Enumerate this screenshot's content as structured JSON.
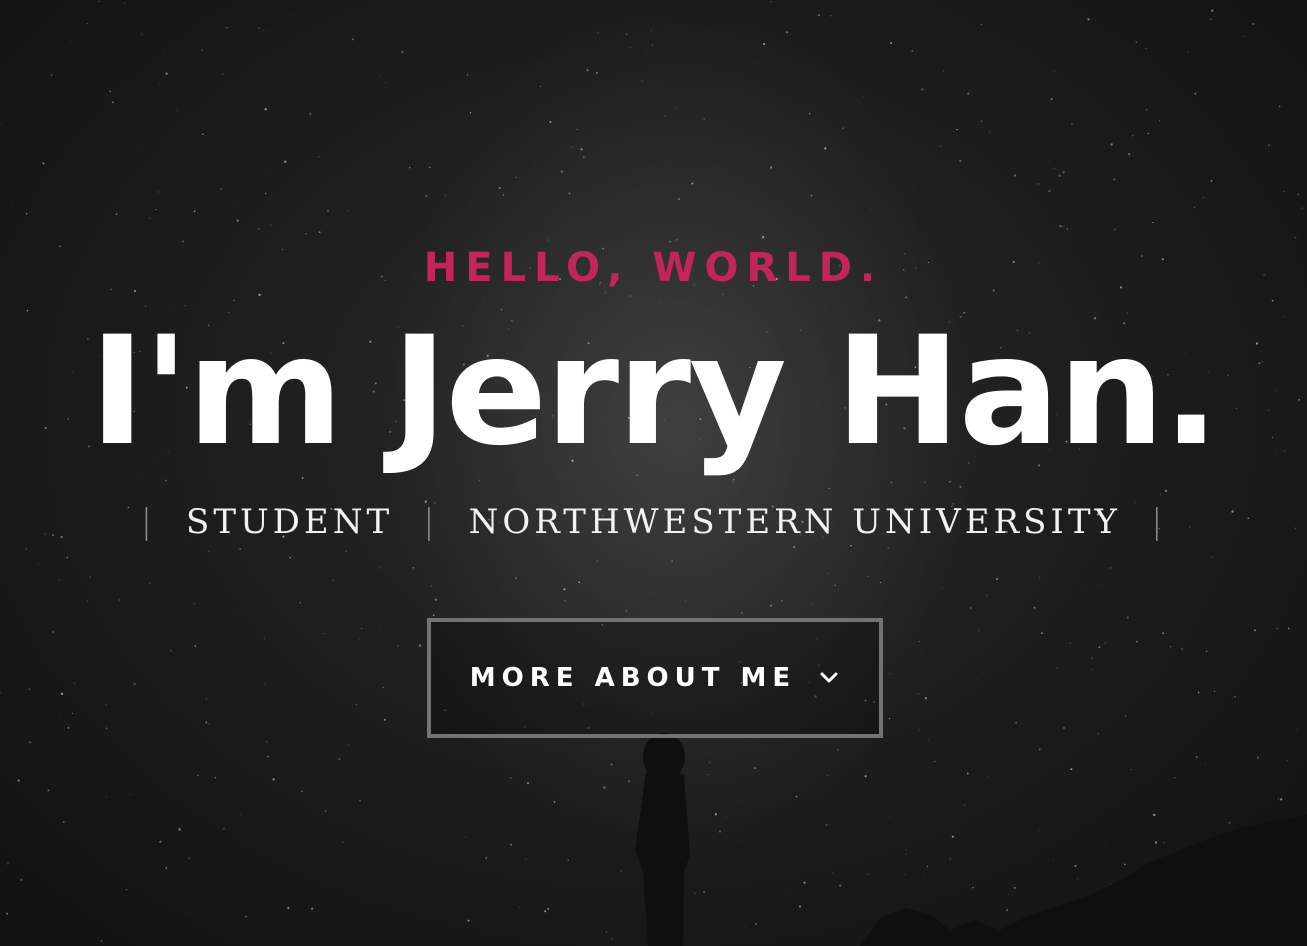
{
  "hero": {
    "greeting": "HELLO, WORLD.",
    "headline": "I'm Jerry Han.",
    "roles": [
      "STUDENT",
      "NORTHWESTERN UNIVERSITY"
    ],
    "separator": "|",
    "cta_label": "MORE ABOUT ME",
    "cta_icon": "chevron-down-icon"
  },
  "colors": {
    "accent": "#c2255c",
    "background": "#151515",
    "text": "#ffffff",
    "button_border": "#737373"
  }
}
